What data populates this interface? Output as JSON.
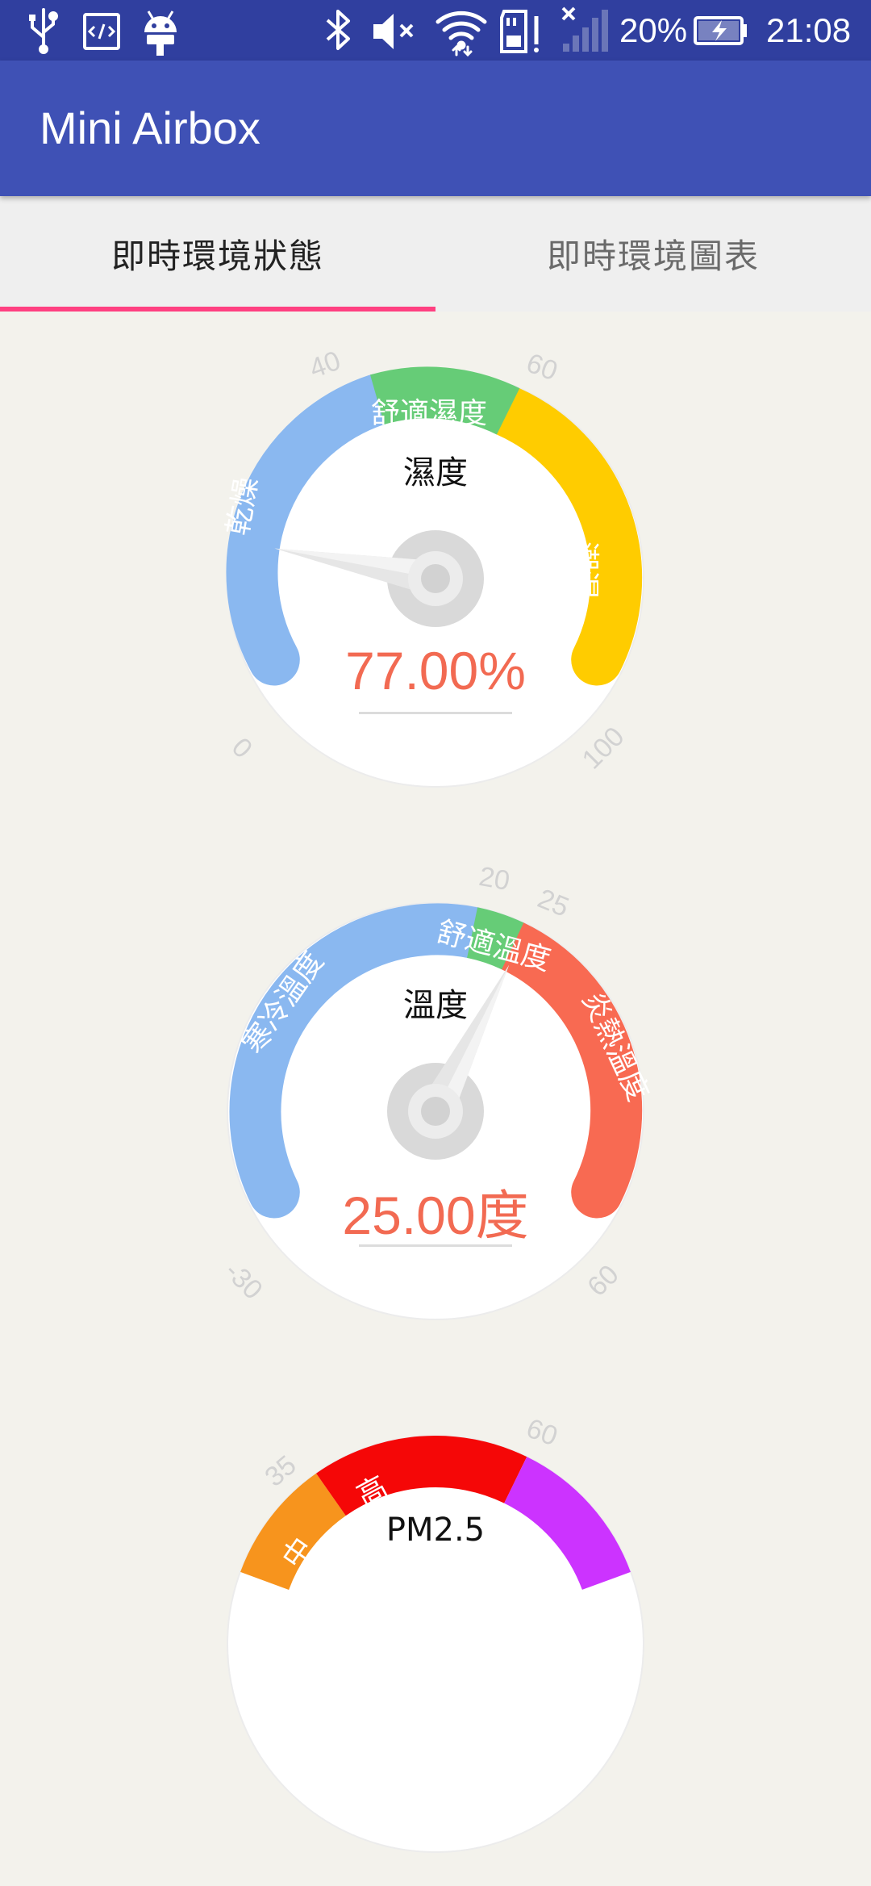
{
  "status_bar": {
    "icons": [
      "usb-icon",
      "code-icon",
      "android-icon",
      "bluetooth-icon",
      "mute-icon",
      "wifi-icon",
      "sd-card-icon",
      "signal-icon",
      "battery-icon"
    ],
    "battery": "20%",
    "time": "21:08"
  },
  "app_bar": {
    "title": "Mini Airbox"
  },
  "tabs": [
    {
      "label": "即時環境狀態",
      "selected": true
    },
    {
      "label": "即時環境圖表",
      "selected": false
    }
  ],
  "colors": {
    "status_bar": "#303f9f",
    "app_bar": "#3f51b5",
    "tab_indicator": "#ff4081",
    "blue_zone": "#8ab8f0",
    "green_zone": "#66cc77",
    "yellow_zone": "#ffcc00",
    "red_zone": "#f86a52",
    "value_text": "#f26a52"
  },
  "gauges": {
    "humidity": {
      "title": "濕度",
      "value": 77,
      "value_text": "77.00%",
      "range": [
        0,
        100
      ],
      "ticks": [
        "0",
        "40",
        "60",
        "100"
      ],
      "zones": {
        "dry": "乾燥",
        "comfort": "舒適濕度",
        "humid": "潮濕"
      }
    },
    "temperature": {
      "title": "溫度",
      "value": 25,
      "value_text": "25.00度",
      "range": [
        -30,
        60
      ],
      "ticks": [
        "-30",
        "20",
        "25",
        "60"
      ],
      "zones": {
        "cold": "寒冷溫度",
        "comfort": "舒適溫度",
        "hot": "炎熱溫度"
      }
    },
    "pm25": {
      "title": "PM2.5",
      "ticks": [
        "35",
        "60"
      ],
      "zones": {
        "high": "高",
        "mid": "中"
      }
    }
  }
}
